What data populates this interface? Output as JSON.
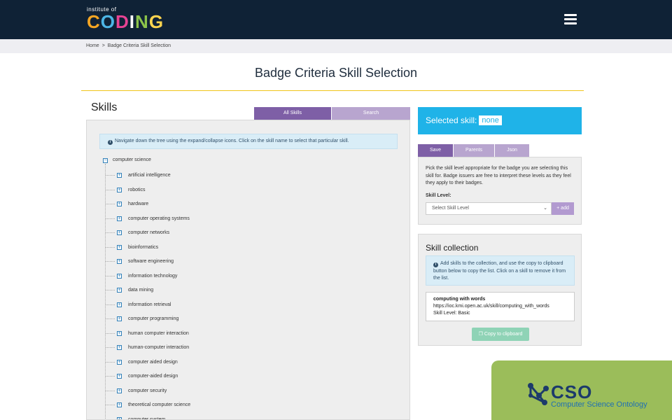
{
  "header": {
    "logo_small": "institute of",
    "logo_big": [
      "C",
      "O",
      "D",
      "I",
      "N",
      "G"
    ],
    "logo_colors": [
      "#f5a623",
      "#4db6e6",
      "#e84393",
      "#ffffff",
      "#8bc34a",
      "#ffd54f"
    ],
    "menu_icon": "hamburger-icon",
    "background": "#0f2236"
  },
  "breadcrumb": {
    "home": "Home",
    "separator": ">",
    "current": "Badge Criteria Skill Selection"
  },
  "page": {
    "title": "Badge Criteria Skill Selection",
    "accent_rule_color": "#f0c419"
  },
  "skills": {
    "heading": "Skills",
    "tabs": [
      {
        "label": "All Skills",
        "active": true
      },
      {
        "label": "Search",
        "active": false
      }
    ],
    "info": "Navigate down the tree using the expand/collapse icons. Click on the skill name to select that particular skill.",
    "root": {
      "label": "computer science",
      "toggle": "⊟"
    },
    "children": [
      "artificial intelligence",
      "robotics",
      "hardware",
      "computer operating systems",
      "computer networks",
      "bioinformatics",
      "software engineering",
      "information technology",
      "data mining",
      "information retrieval",
      "computer programming",
      "human computer interaction",
      "human-computer interaction",
      "computer aided design",
      "computer-aided design",
      "computer security",
      "theoretical computer science",
      "computer system"
    ],
    "child_toggle": "+"
  },
  "selected": {
    "label": "Selected skill:",
    "value": "none",
    "color": "#1fb3e8"
  },
  "right_tabs": [
    {
      "label": "Save",
      "active": true
    },
    {
      "label": "Parents",
      "active": false
    },
    {
      "label": "Json",
      "active": false
    }
  ],
  "save_panel": {
    "description": "Pick the skill level appropriate for the badge you are selecting this skill for. Badge issuers are free to interpret these levels as they feel they apply to their badges.",
    "level_label": "Skill Level:",
    "select_placeholder": "Select Skill Level",
    "add_label": "+ add"
  },
  "collection": {
    "title": "Skill collection",
    "info": "Add skills to the collection, and use the copy to clipboard button below to copy the list. Click on a skill to remove it from the list.",
    "items": [
      {
        "name": "computing with words",
        "url": "https://ioc.kmi.open.ac.uk/skill/computing_with_words",
        "level": "Skill Level: Basic"
      }
    ],
    "copy_label": "Copy to clipboard"
  },
  "cso": {
    "title": "CSO",
    "subtitle": "Computer Science Ontology",
    "background": "#9bbd5a"
  }
}
